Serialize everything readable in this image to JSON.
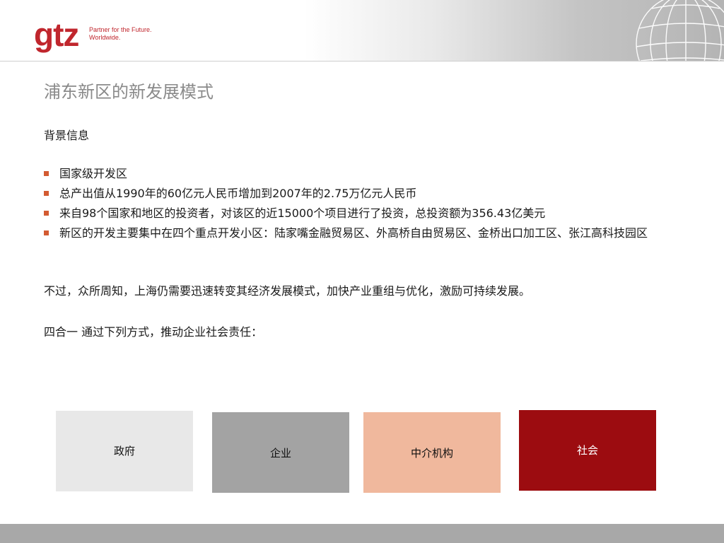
{
  "header": {
    "logo_text": "gtz",
    "tagline_line1": "Partner for the Future.",
    "tagline_line2": "Worldwide."
  },
  "slide": {
    "title": "浦东新区的新发展模式",
    "section_label": "背景信息",
    "bullets": [
      "国家级开发区",
      "总产出值从1990年的60亿元人民币增加到2007年的2.75万亿元人民币",
      "来自98个国家和地区的投资者，对该区的近15000个项目进行了投资，总投资额为356.43亿美元",
      "新区的开发主要集中在四个重点开发小区：陆家嘴金融贸易区、外高桥自由贸易区、金桥出口加工区、张江高科技园区"
    ],
    "paragraph1": "不过，众所周知，上海仍需要迅速转变其经济发展模式，加快产业重组与优化，激励可持续发展。",
    "paragraph2": "四合一 通过下列方式，推动企业社会责任："
  },
  "boxes": {
    "government": "政府",
    "enterprise": "企业",
    "intermediary": "中介机构",
    "society": "社会"
  },
  "colors": {
    "brand_red": "#c0262d",
    "bullet_orange": "#d35b32",
    "box_gray_light": "#e8e8e8",
    "box_gray_dark": "#a3a3a3",
    "box_peach": "#f0b89d",
    "box_dark_red": "#9c0c10"
  }
}
